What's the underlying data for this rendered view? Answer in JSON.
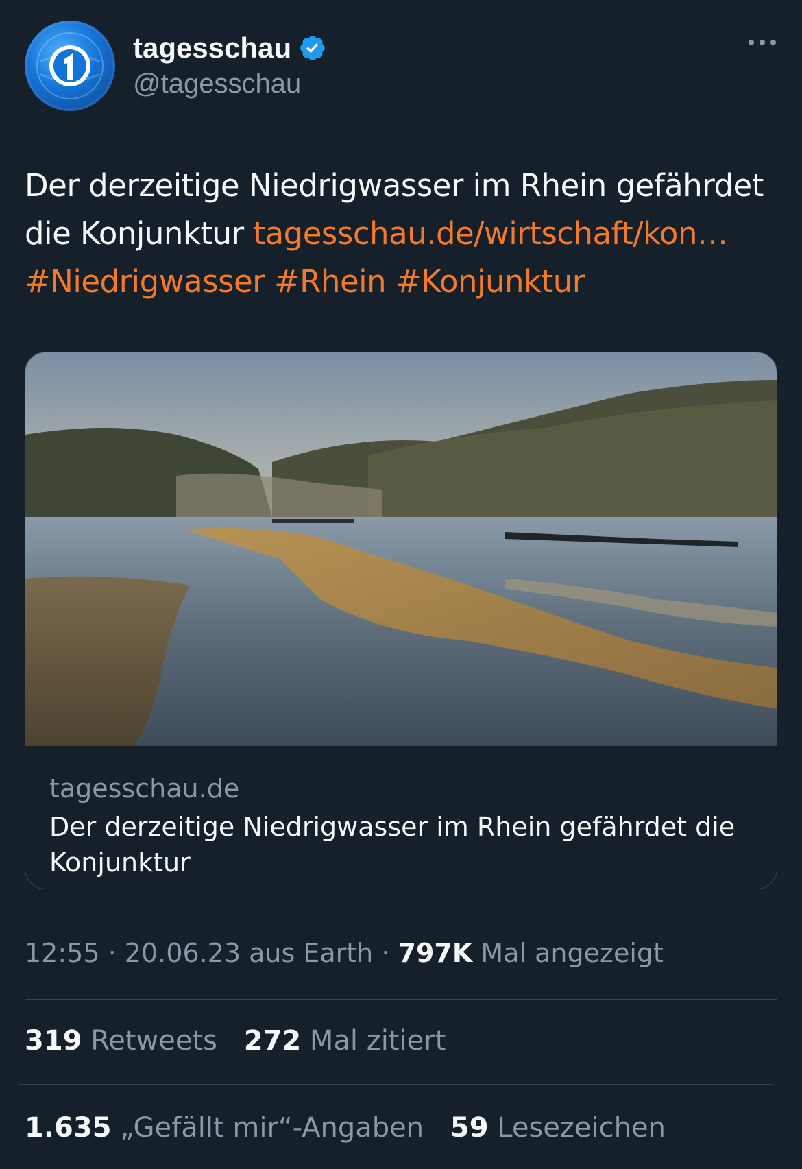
{
  "account": {
    "display_name": "tagesschau",
    "handle": "@tagesschau",
    "verified_icon": "verified-badge-icon",
    "avatar_icon": "tagesschau-logo"
  },
  "tweet": {
    "text_lines": [
      "Der derzeitige Niedrigwasser im Rhein gefährdet",
      "die Konjunktur "
    ],
    "link_text": "tagesschau.de/wirtschaft/kon…",
    "hashtags": [
      "#Niedrigwasser",
      "#Rhein",
      "#Konjunktur"
    ]
  },
  "card": {
    "domain": "tagesschau.de",
    "title": "Der derzeitige Niedrigwasser im Rhein gefährdet die Konjunktur"
  },
  "meta": {
    "time": "12:55",
    "date": "20.06.23",
    "source": "aus Earth",
    "views_count": "797K",
    "views_label": "Mal angezeigt"
  },
  "stats": {
    "retweets_count": "319",
    "retweets_label": "Retweets",
    "quotes_count": "272",
    "quotes_label": "Mal zitiert",
    "likes_count": "1.635",
    "likes_label": "„Gefällt mir“-Angaben",
    "bookmarks_count": "59",
    "bookmarks_label": "Lesezeichen"
  },
  "colors": {
    "background": "#15202b",
    "text": "#f7f9f9",
    "secondary": "#8b98a5",
    "link": "#f47a2a",
    "verified": "#1d9bf0",
    "border": "#38444d"
  }
}
